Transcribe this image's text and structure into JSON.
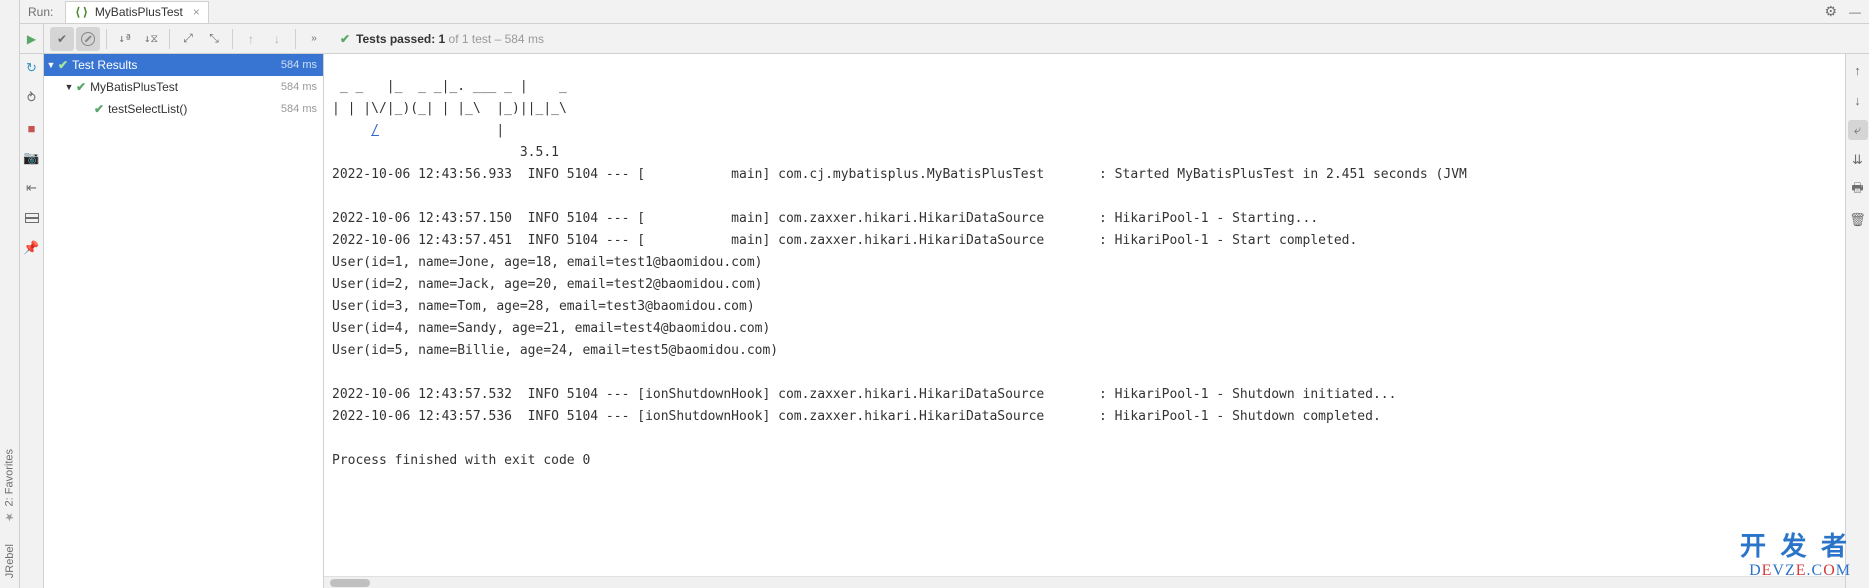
{
  "header": {
    "run_label": "Run:",
    "tab_name": "MyBatisPlusTest"
  },
  "toolbar": {
    "status_prefix": "Tests passed: 1",
    "status_suffix": " of 1 test – 584 ms"
  },
  "tree": {
    "root": {
      "label": "Test Results",
      "time": "584 ms"
    },
    "class": {
      "label": "MyBatisPlusTest",
      "time": "584 ms"
    },
    "method": {
      "label": "testSelectList()",
      "time": "584 ms"
    }
  },
  "console": {
    "l0": " _ _   |_  _ _|_. ___ _ |    _ ",
    "l1": "| | |\\/|_)(_| | |_\\  |_)||_|_\\ ",
    "l2_plain": "     ",
    "l2_link": "/",
    "l2_tail": "               |         ",
    "l3": "                        3.5.1 ",
    "l4": "2022-10-06 12:43:56.933  INFO 5104 --- [           main] com.cj.mybatisplus.MyBatisPlusTest       : Started MyBatisPlusTest in 2.451 seconds (JVM ",
    "l5": "2022-10-06 12:43:57.150  INFO 5104 --- [           main] com.zaxxer.hikari.HikariDataSource       : HikariPool-1 - Starting...",
    "l6": "2022-10-06 12:43:57.451  INFO 5104 --- [           main] com.zaxxer.hikari.HikariDataSource       : HikariPool-1 - Start completed.",
    "l7": "User(id=1, name=Jone, age=18, email=test1@baomidou.com)",
    "l8": "User(id=2, name=Jack, age=20, email=test2@baomidou.com)",
    "l9": "User(id=3, name=Tom, age=28, email=test3@baomidou.com)",
    "l10": "User(id=4, name=Sandy, age=21, email=test4@baomidou.com)",
    "l11": "User(id=5, name=Billie, age=24, email=test5@baomidou.com)",
    "l12": "2022-10-06 12:43:57.532  INFO 5104 --- [ionShutdownHook] com.zaxxer.hikari.HikariDataSource       : HikariPool-1 - Shutdown initiated...",
    "l13": "2022-10-06 12:43:57.536  INFO 5104 --- [ionShutdownHook] com.zaxxer.hikari.HikariDataSource       : HikariPool-1 - Shutdown completed.",
    "l14": "Process finished with exit code 0"
  },
  "side_tabs": {
    "favorites": "2: Favorites",
    "jrebel": "JRebel"
  },
  "watermark": {
    "top": "开 发 者",
    "bot_pre": "D",
    "bot_e1": "E",
    "bot_v": "VZ",
    "bot_e2": "E",
    "bot_post": ".C",
    "bot_o": "O",
    "bot_m": "M"
  }
}
